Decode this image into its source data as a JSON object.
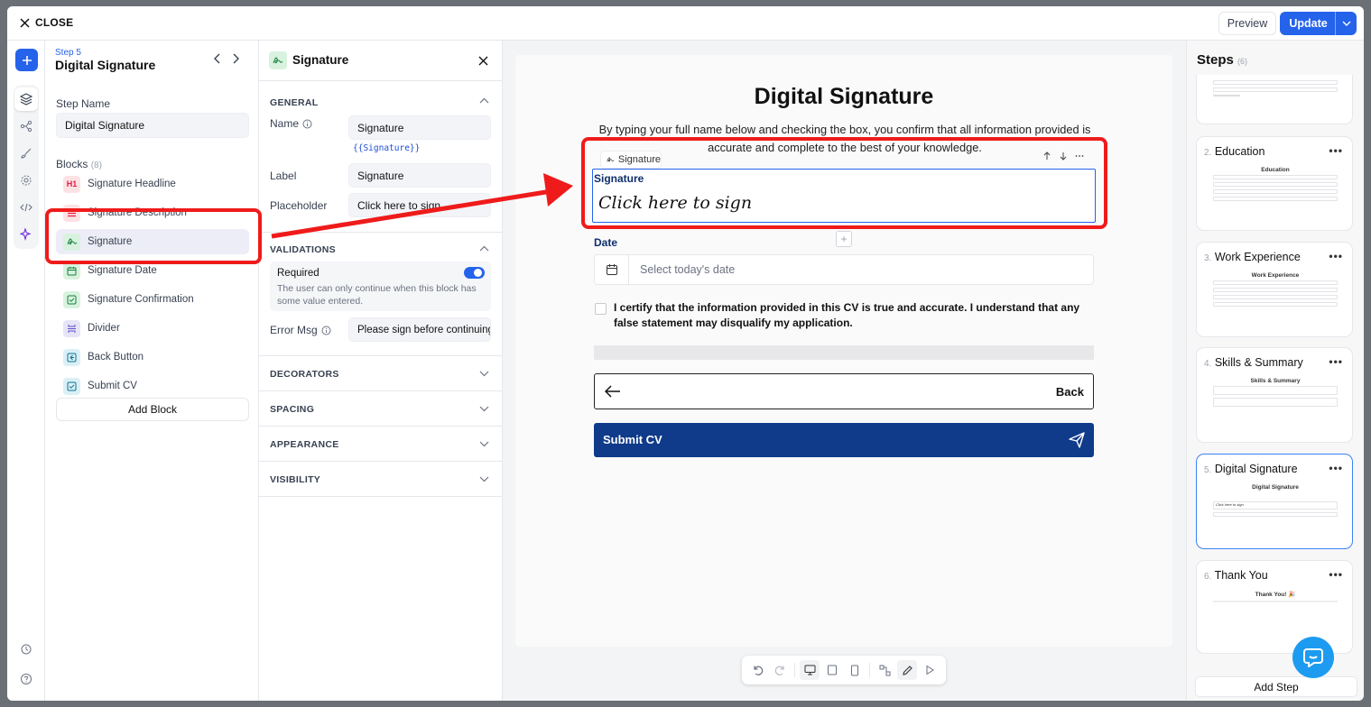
{
  "topbar": {
    "close_label": "CLOSE",
    "preview_label": "Preview",
    "update_label": "Update"
  },
  "step": {
    "number_label": "Step 5",
    "title": "Digital Signature",
    "name_label": "Step Name",
    "name_value": "Digital Signature"
  },
  "blocks": {
    "label": "Blocks",
    "count": "(8)",
    "items": [
      {
        "label": "Signature Headline",
        "icon": "H1"
      },
      {
        "label": "Signature Description",
        "icon": "text-lines-icon"
      },
      {
        "label": "Signature",
        "icon": "signature-icon"
      },
      {
        "label": "Signature Date",
        "icon": "calendar-icon"
      },
      {
        "label": "Signature Confirmation",
        "icon": "checkbox-icon"
      },
      {
        "label": "Divider",
        "icon": "divider-icon"
      },
      {
        "label": "Back Button",
        "icon": "back-icon"
      },
      {
        "label": "Submit CV",
        "icon": "checkbox-icon"
      }
    ],
    "add_label": "Add Block"
  },
  "props": {
    "title": "Signature",
    "general": "GENERAL",
    "name_label": "Name",
    "name_value": "Signature",
    "name_var": "{{Signature}}",
    "label_label": "Label",
    "label_value": "Signature",
    "placeholder_label": "Placeholder",
    "placeholder_value": "Click here to sign",
    "validations": "VALIDATIONS",
    "required_label": "Required",
    "required_on": true,
    "required_help": "The user can only continue when this block has some value entered.",
    "error_label": "Error Msg",
    "error_value": "Please sign before continuing",
    "decorators": "DECORATORS",
    "spacing": "SPACING",
    "appearance": "APPEARANCE",
    "visibility": "VISIBILITY"
  },
  "canvas": {
    "title": "Digital Signature",
    "description": "By typing your full name below and checking the box, you confirm that all information provided is accurate and complete to the best of your knowledge.",
    "sig_tag": "Signature",
    "sig_label": "Signature",
    "sig_placeholder": "Click here to sign",
    "date_label": "Date",
    "date_placeholder": "Select today's date",
    "cert_text": "I certify that the information provided in this CV is true and accurate. I understand that any false statement may disqualify my application.",
    "back_label": "Back",
    "submit_label": "Submit CV"
  },
  "steps": {
    "title": "Steps",
    "count": "(6)",
    "items": [
      {
        "num": "2.",
        "title": "Education",
        "thumb_title": "Education"
      },
      {
        "num": "3.",
        "title": "Work Experience",
        "thumb_title": "Work Experience"
      },
      {
        "num": "4.",
        "title": "Skills & Summary",
        "thumb_title": "Skills & Summary"
      },
      {
        "num": "5.",
        "title": "Digital Signature",
        "thumb_title": "Digital Signature"
      },
      {
        "num": "6.",
        "title": "Thank You",
        "thumb_title": "Thank You! 🎉"
      }
    ],
    "thumb_placeholder": "Click here to sign",
    "add_label": "Add Step"
  },
  "colors": {
    "accent": "#2563eb",
    "submit": "#103a8a",
    "annotation": "#ef1b1b"
  }
}
